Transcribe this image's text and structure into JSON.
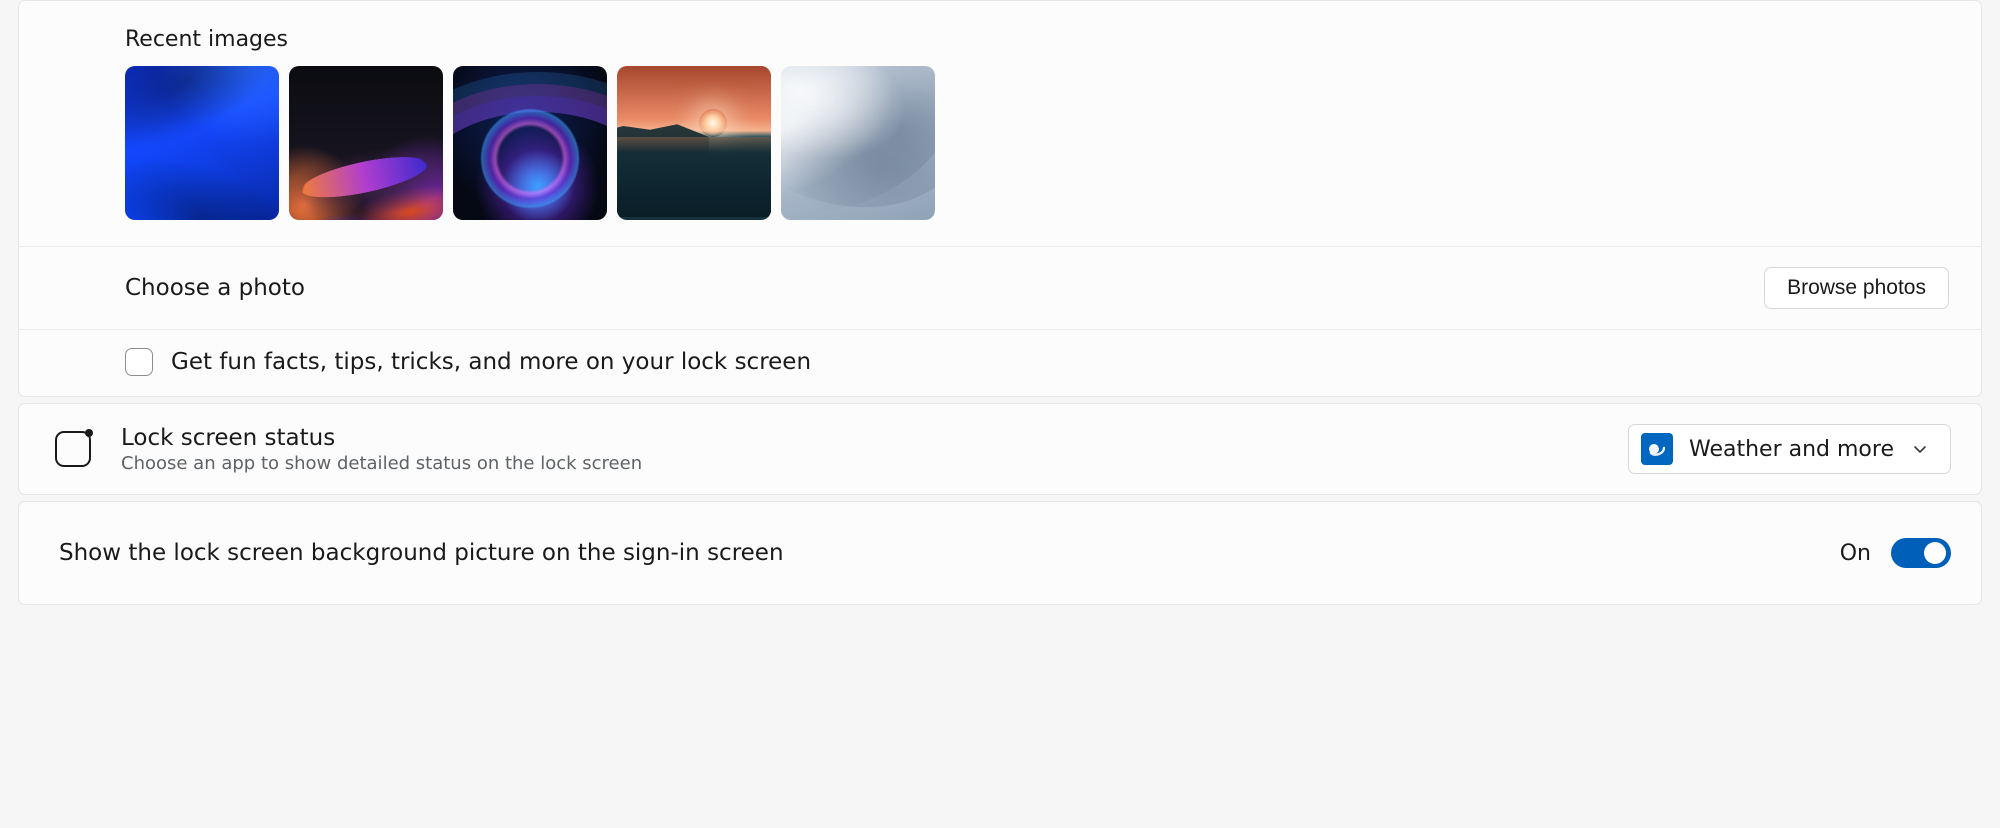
{
  "recent": {
    "heading": "Recent images"
  },
  "choose": {
    "label": "Choose a photo",
    "button": "Browse photos"
  },
  "funfacts": {
    "label": "Get fun facts, tips, tricks, and more on your lock screen",
    "checked": false
  },
  "status": {
    "title": "Lock screen status",
    "subtitle": "Choose an app to show detailed status on the lock screen",
    "selected": "Weather and more"
  },
  "signin_toggle": {
    "label": "Show the lock screen background picture on the sign-in screen",
    "state_text": "On",
    "on": true
  }
}
